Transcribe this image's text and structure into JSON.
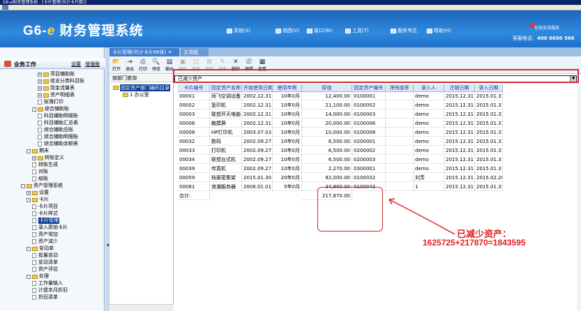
{
  "window": {
    "title": "G6-e财务管理系统 - [卡片管理(共计卡片数)]"
  },
  "header": {
    "logo_prefix": "G6-",
    "logo_e": "e",
    "logo_text": " 财务管理系统",
    "nav": [
      {
        "label": "系统(S)",
        "icon": "system-icon"
      },
      {
        "label": "视图(V)",
        "icon": "view-icon"
      },
      {
        "label": "窗口(W)",
        "icon": "window-icon"
      },
      {
        "label": "工具(T)",
        "icon": "tools-icon"
      },
      {
        "label": "服务专区",
        "icon": "service-icon"
      },
      {
        "label": "帮助(H)",
        "icon": "help-icon"
      }
    ],
    "service": "在线支持服务",
    "hotline_label": "客服电话：",
    "hotline": "400 6600 566"
  },
  "left": {
    "title": "业务工作",
    "link1": "设置",
    "link2": "增强版",
    "tree": [
      {
        "label": "项目辅助账",
        "indent": 3,
        "kind": "folder",
        "exp": "+"
      },
      {
        "label": "收支分类科目账",
        "indent": 3,
        "kind": "folder",
        "exp": "+"
      },
      {
        "label": "现金流量表",
        "indent": 3,
        "kind": "folder",
        "exp": "+"
      },
      {
        "label": "资产明细表",
        "indent": 3,
        "kind": "folder",
        "exp": "+"
      },
      {
        "label": "账簿打印",
        "indent": 3,
        "kind": "doc",
        "exp": ""
      },
      {
        "label": "综合辅助账",
        "indent": 2,
        "kind": "folder",
        "exp": "-"
      },
      {
        "label": "科目辅助明细账",
        "indent": 3,
        "kind": "doc",
        "exp": ""
      },
      {
        "label": "科目辅助汇总表",
        "indent": 3,
        "kind": "doc",
        "exp": ""
      },
      {
        "label": "综合辅助总账",
        "indent": 3,
        "kind": "doc",
        "exp": ""
      },
      {
        "label": "综合辅助明细账",
        "indent": 3,
        "kind": "doc",
        "exp": ""
      },
      {
        "label": "综合辅助余额表",
        "indent": 3,
        "kind": "doc",
        "exp": ""
      },
      {
        "label": "期末",
        "indent": 1,
        "kind": "folder",
        "exp": "-"
      },
      {
        "label": "转账定义",
        "indent": 2,
        "kind": "folder",
        "exp": "+"
      },
      {
        "label": "转账生成",
        "indent": 2,
        "kind": "doc",
        "exp": ""
      },
      {
        "label": "对账",
        "indent": 2,
        "kind": "doc",
        "exp": ""
      },
      {
        "label": "结账",
        "indent": 2,
        "kind": "doc",
        "exp": ""
      },
      {
        "label": "资产管理系统",
        "indent": 0,
        "kind": "folder",
        "exp": "-"
      },
      {
        "label": "设置",
        "indent": 1,
        "kind": "folder",
        "exp": "+"
      },
      {
        "label": "卡片",
        "indent": 1,
        "kind": "folder",
        "exp": "-"
      },
      {
        "label": "卡片项目",
        "indent": 2,
        "kind": "doc",
        "exp": ""
      },
      {
        "label": "卡片样式",
        "indent": 2,
        "kind": "doc",
        "exp": ""
      },
      {
        "label": "卡片管理",
        "indent": 2,
        "kind": "doc",
        "exp": "",
        "selected": true
      },
      {
        "label": "录入原始卡片",
        "indent": 2,
        "kind": "doc",
        "exp": ""
      },
      {
        "label": "资产增加",
        "indent": 2,
        "kind": "doc",
        "exp": ""
      },
      {
        "label": "资产减少",
        "indent": 2,
        "kind": "doc",
        "exp": ""
      },
      {
        "label": "变动单",
        "indent": 1,
        "kind": "folder",
        "exp": "-"
      },
      {
        "label": "批量变动",
        "indent": 2,
        "kind": "doc",
        "exp": ""
      },
      {
        "label": "变动清单",
        "indent": 2,
        "kind": "doc",
        "exp": ""
      },
      {
        "label": "资产评估",
        "indent": 2,
        "kind": "doc",
        "exp": ""
      },
      {
        "label": "处理",
        "indent": 1,
        "kind": "folder",
        "exp": "-"
      },
      {
        "label": "工作量输入",
        "indent": 2,
        "kind": "doc",
        "exp": ""
      },
      {
        "label": "计提本月折旧",
        "indent": 2,
        "kind": "doc",
        "exp": ""
      },
      {
        "label": "折旧清单",
        "indent": 2,
        "kind": "doc",
        "exp": ""
      }
    ]
  },
  "tabs": [
    {
      "label": "卡片管理(共计卡片66张)",
      "close": "✕"
    },
    {
      "label": "主流程"
    }
  ],
  "toolbar": [
    {
      "label": "打开",
      "icon": "open-icon",
      "glyph": "📂",
      "enabled": true
    },
    {
      "label": "退出",
      "icon": "exit-icon",
      "glyph": "⇥",
      "enabled": true
    },
    {
      "label": "打印",
      "icon": "print-icon",
      "glyph": "⎙",
      "enabled": true
    },
    {
      "label": "预览",
      "icon": "preview-icon",
      "glyph": "🔍",
      "enabled": true
    },
    {
      "label": "输出",
      "icon": "export-icon",
      "glyph": "▤",
      "enabled": true
    },
    {
      "label": "保存",
      "icon": "save-icon",
      "glyph": "▣",
      "enabled": false
    },
    {
      "label": "查看",
      "icon": "view-icon",
      "glyph": "◫",
      "enabled": false
    },
    {
      "label": "添加",
      "icon": "add-icon",
      "glyph": "⊞",
      "enabled": false
    },
    {
      "label": "修改",
      "icon": "edit-icon",
      "glyph": "✎",
      "enabled": false
    },
    {
      "label": "删除",
      "icon": "delete-icon",
      "glyph": "✕",
      "enabled": true
    },
    {
      "label": "编辑",
      "icon": "edit2-icon",
      "glyph": "⎚",
      "enabled": true
    },
    {
      "label": "查看",
      "icon": "view2-icon",
      "glyph": "▦",
      "enabled": true
    }
  ],
  "dept": {
    "query_label": "按部门查询",
    "nodes": [
      {
        "label": "固定资产部门编码目录",
        "level": 0,
        "selected": true
      },
      {
        "label": "1 办公室",
        "level": 1,
        "selected": false
      }
    ]
  },
  "filter": {
    "value": "已减少资产"
  },
  "grid": {
    "columns": [
      "卡片编号",
      "固定资产名称",
      "开始使用日期",
      "使用年限",
      "原值",
      "固定资产编号",
      "净残值率",
      "录入人",
      "注销日期",
      "录入日期"
    ],
    "rows": [
      [
        "00001",
        "同飞空调设备",
        "2002.12.31",
        "10年0月",
        "12,400.00",
        "0100001",
        "",
        "demo",
        "2015.12.31",
        "2015.01.31"
      ],
      [
        "00002",
        "复印机",
        "2002.12.31",
        "10年0月",
        "21,100.00",
        "0100002",
        "",
        "demo",
        "2015.12.31",
        "2015.01.31"
      ],
      [
        "00003",
        "联想开天电脑",
        "2002.12.31",
        "10年0月",
        "14,000.00",
        "0100003",
        "",
        "demo",
        "2015.12.31",
        "2015.01.31"
      ],
      [
        "00006",
        "触摸屏",
        "2002.12.31",
        "10年0月",
        "20,000.00",
        "0100006",
        "",
        "demo",
        "2015.12.31",
        "2015.01.31"
      ],
      [
        "00008",
        "HP打印机",
        "2003.07.03",
        "10年0月",
        "10,000.00",
        "0100008",
        "",
        "demo",
        "2015.12.31",
        "2015.01.31"
      ],
      [
        "00032",
        "数码",
        "2002.09.27",
        "10年0月",
        "6,500.00",
        "0200001",
        "",
        "demo",
        "2015.12.31",
        "2015.01.31"
      ],
      [
        "00033",
        "打印机",
        "2002.09.27",
        "10年0月",
        "6,500.00",
        "0200002",
        "",
        "demo",
        "2015.12.31",
        "2015.01.31"
      ],
      [
        "00034",
        "联想台式机",
        "2002.09.27",
        "10年0月",
        "6,500.00",
        "0200003",
        "",
        "demo",
        "2015.12.31",
        "2015.01.31"
      ],
      [
        "00039",
        "传真机",
        "2002.09.27",
        "10年0月",
        "2,270.00",
        "0300001",
        "",
        "demo",
        "2015.12.31",
        "2015.01.31"
      ],
      [
        "00059",
        "档案密集架",
        "2015.01.30",
        "20年0月",
        "82,000.00",
        "0100032",
        "",
        "刘芳",
        "2015.12.31",
        "2015.02.28"
      ],
      [
        "00081",
        "浪潮服务器",
        "2006.01.01",
        "5年0月",
        "34,900.00",
        "0100042",
        "",
        "1",
        "2015.12.31",
        "2015.01.31"
      ]
    ],
    "total_label": "合计:",
    "total_value": "217,870.00"
  },
  "annotation": {
    "line1": "已减少资产：",
    "line2": "1625725+217870=1843595"
  }
}
